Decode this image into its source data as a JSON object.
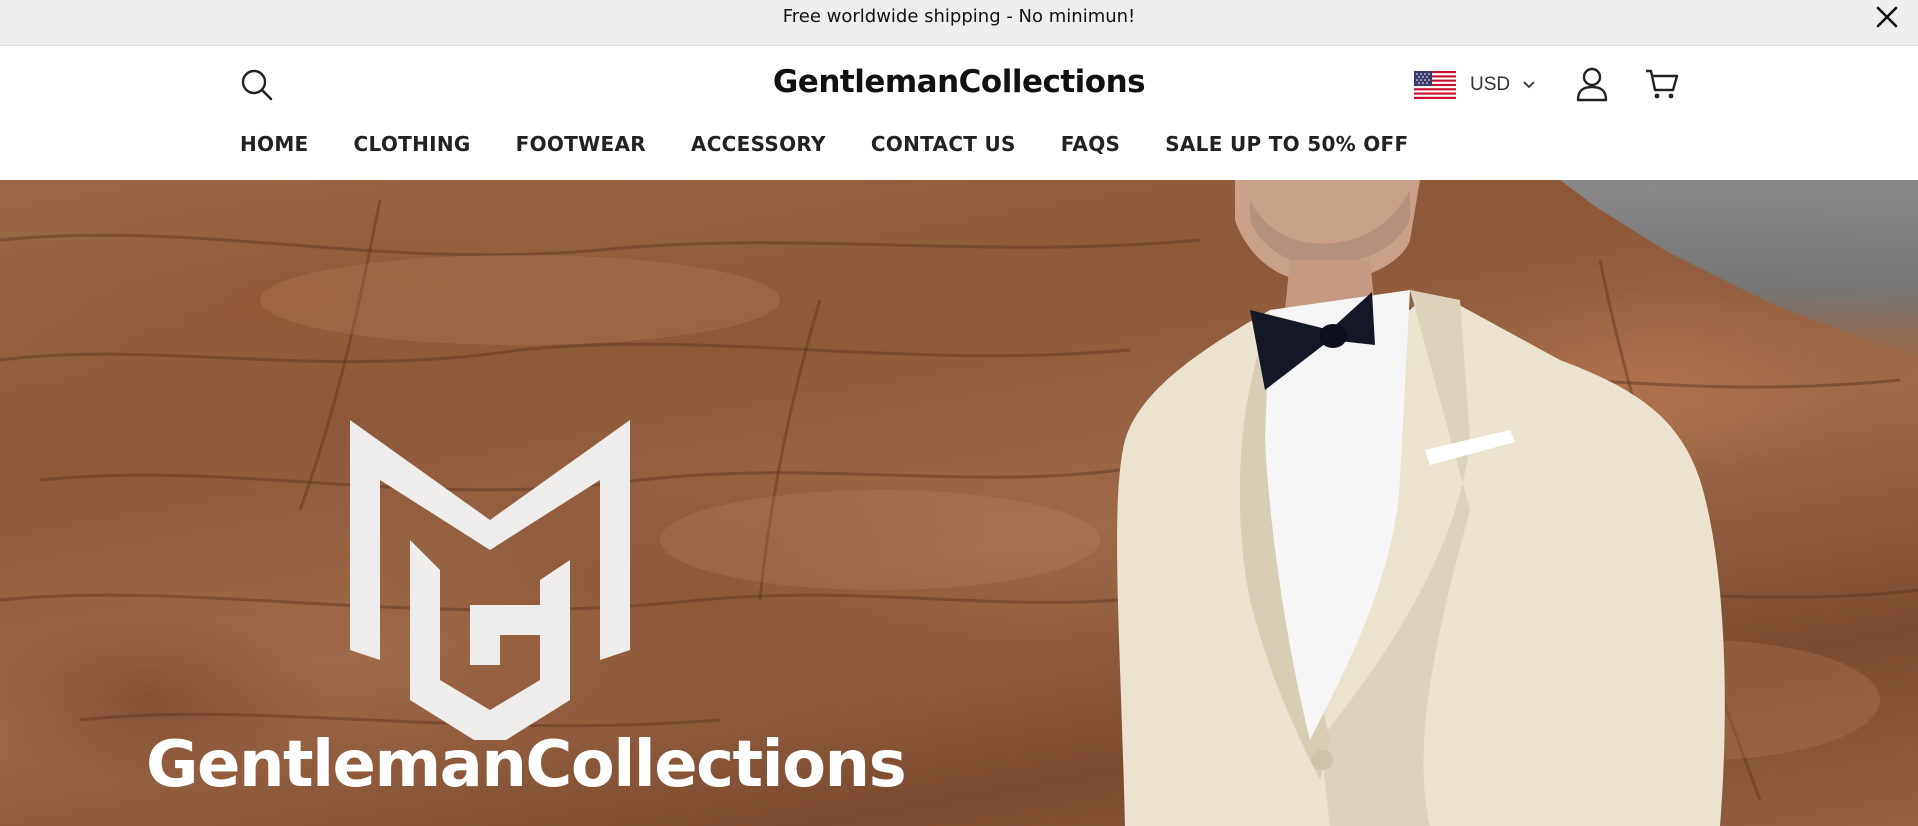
{
  "announcement": {
    "text": "Free worldwide shipping - No minimun!",
    "close_icon": "close-icon"
  },
  "header": {
    "brand": "GentlemanCollections",
    "search_icon": "search-icon",
    "currency": {
      "flag": "us-flag-icon",
      "code": "USD",
      "chevron": "chevron-down-icon"
    },
    "account_icon": "user-icon",
    "cart_icon": "cart-icon"
  },
  "nav": {
    "items": [
      {
        "label": "HOME"
      },
      {
        "label": "CLOTHING"
      },
      {
        "label": "FOOTWEAR"
      },
      {
        "label": "ACCESSORY"
      },
      {
        "label": "CONTACT US"
      },
      {
        "label": "FAQS"
      },
      {
        "label": "SALE UP TO 50% OFF"
      }
    ]
  },
  "hero": {
    "brand": "GentlemanCollections",
    "logo": "gm-monogram-logo"
  },
  "colors": {
    "announcement_bg": "#eeeeee",
    "text": "#111111",
    "hero_text": "#ffffff"
  }
}
